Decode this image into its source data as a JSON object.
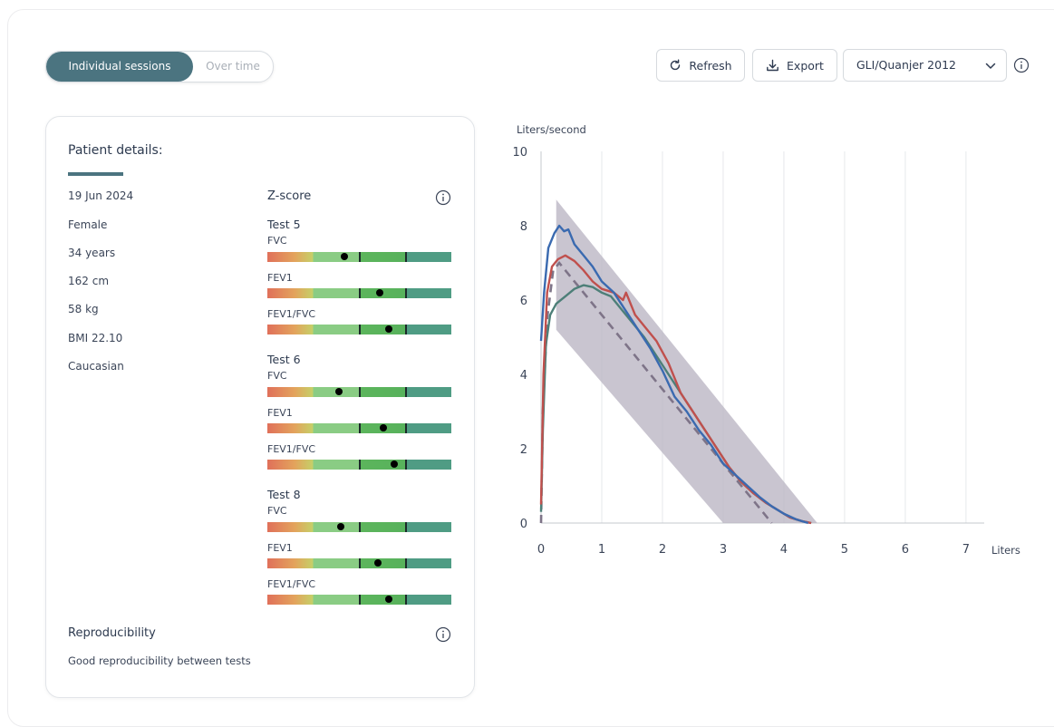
{
  "toggle": {
    "active": "Individual sessions",
    "inactive": "Over time"
  },
  "toolbar": {
    "refresh": "Refresh",
    "export": "Export",
    "reference": "GLI/Quanjer 2012"
  },
  "patient": {
    "title": "Patient details:",
    "details": [
      "19 Jun 2024",
      "Female",
      "34 years",
      "162 cm",
      "58 kg",
      "BMI 22.10",
      "Caucasian"
    ]
  },
  "zscore": {
    "title": "Z-score",
    "tests": [
      {
        "name": "Test 5",
        "metrics": [
          {
            "label": "FVC",
            "position": 0.42
          },
          {
            "label": "FEV1",
            "position": 0.61
          },
          {
            "label": "FEV1/FVC",
            "position": 0.66
          }
        ]
      },
      {
        "name": "Test 6",
        "metrics": [
          {
            "label": "FVC",
            "position": 0.39
          },
          {
            "label": "FEV1",
            "position": 0.63
          },
          {
            "label": "FEV1/FVC",
            "position": 0.69
          }
        ]
      },
      {
        "name": "Test 8",
        "metrics": [
          {
            "label": "FVC",
            "position": 0.4
          },
          {
            "label": "FEV1",
            "position": 0.6
          },
          {
            "label": "FEV1/FVC",
            "position": 0.66
          }
        ]
      }
    ]
  },
  "reproducibility": {
    "title": "Reproducibility",
    "text": "Good reproducibility between tests"
  },
  "colors": {
    "accent": "#4b7480",
    "curve_blue": "#3a6ab0",
    "curve_red": "#c0504d",
    "curve_teal": "#4d7f78",
    "predicted": "#7e7488",
    "band": "#bbb6c4"
  },
  "chart_data": {
    "type": "line",
    "ylabel": "Liters/second",
    "xlabel": "Liters",
    "xlim": [
      0,
      7.3
    ],
    "ylim": [
      0,
      10
    ],
    "x_ticks": [
      0,
      1,
      2,
      3,
      4,
      5,
      6,
      7
    ],
    "y_ticks": [
      0,
      2,
      4,
      6,
      8,
      10
    ],
    "grid": "vertical",
    "band": {
      "upper": [
        [
          0.25,
          8.7
        ],
        [
          4.55,
          0
        ]
      ],
      "lower": [
        [
          0.25,
          5.2
        ],
        [
          3.0,
          0
        ]
      ]
    },
    "predicted": [
      [
        0,
        0
      ],
      [
        0.03,
        3.0
      ],
      [
        0.1,
        5.5
      ],
      [
        0.2,
        6.8
      ],
      [
        0.3,
        7.0
      ],
      [
        3.8,
        0
      ]
    ],
    "series": [
      {
        "color": "#3a6ab0",
        "points": [
          [
            0,
            4.9
          ],
          [
            0.05,
            6.2
          ],
          [
            0.12,
            7.4
          ],
          [
            0.22,
            7.8
          ],
          [
            0.3,
            8.0
          ],
          [
            0.38,
            7.85
          ],
          [
            0.45,
            7.9
          ],
          [
            0.55,
            7.5
          ],
          [
            0.7,
            7.2
          ],
          [
            0.85,
            6.9
          ],
          [
            1.0,
            6.5
          ],
          [
            1.2,
            6.2
          ],
          [
            1.4,
            5.7
          ],
          [
            1.6,
            5.2
          ],
          [
            1.8,
            4.7
          ],
          [
            2.0,
            4.1
          ],
          [
            2.2,
            3.4
          ],
          [
            2.4,
            3.0
          ],
          [
            2.6,
            2.5
          ],
          [
            2.8,
            2.1
          ],
          [
            3.0,
            1.6
          ],
          [
            3.2,
            1.3
          ],
          [
            3.4,
            1.0
          ],
          [
            3.6,
            0.7
          ],
          [
            3.8,
            0.45
          ],
          [
            4.0,
            0.25
          ],
          [
            4.2,
            0.1
          ],
          [
            4.4,
            0.0
          ]
        ]
      },
      {
        "color": "#c0504d",
        "points": [
          [
            0,
            0.5
          ],
          [
            0.04,
            4.0
          ],
          [
            0.1,
            6.2
          ],
          [
            0.18,
            6.9
          ],
          [
            0.28,
            7.1
          ],
          [
            0.4,
            7.2
          ],
          [
            0.55,
            7.05
          ],
          [
            0.7,
            6.8
          ],
          [
            0.85,
            6.5
          ],
          [
            1.0,
            6.3
          ],
          [
            1.2,
            6.2
          ],
          [
            1.35,
            6.0
          ],
          [
            1.4,
            6.2
          ],
          [
            1.55,
            5.6
          ],
          [
            1.7,
            5.3
          ],
          [
            1.9,
            4.9
          ],
          [
            2.1,
            4.3
          ],
          [
            2.3,
            3.5
          ],
          [
            2.5,
            3.0
          ],
          [
            2.7,
            2.5
          ],
          [
            2.9,
            2.0
          ],
          [
            3.1,
            1.5
          ],
          [
            3.3,
            1.1
          ],
          [
            3.5,
            0.8
          ],
          [
            3.7,
            0.55
          ],
          [
            3.9,
            0.35
          ],
          [
            4.1,
            0.15
          ],
          [
            4.3,
            0.05
          ],
          [
            4.45,
            0.0
          ]
        ]
      },
      {
        "color": "#4d7f78",
        "points": [
          [
            0,
            0.3
          ],
          [
            0.03,
            2.5
          ],
          [
            0.08,
            4.8
          ],
          [
            0.15,
            5.6
          ],
          [
            0.25,
            5.9
          ],
          [
            0.4,
            6.1
          ],
          [
            0.55,
            6.3
          ],
          [
            0.7,
            6.4
          ],
          [
            0.85,
            6.35
          ],
          [
            1.0,
            6.2
          ],
          [
            1.15,
            6.1
          ],
          [
            1.3,
            5.8
          ],
          [
            1.5,
            5.4
          ],
          [
            1.7,
            5.0
          ],
          [
            1.9,
            4.5
          ],
          [
            2.1,
            4.0
          ],
          [
            2.3,
            3.5
          ],
          [
            2.5,
            3.0
          ],
          [
            2.7,
            2.5
          ],
          [
            2.9,
            2.0
          ],
          [
            3.1,
            1.5
          ],
          [
            3.3,
            1.1
          ],
          [
            3.5,
            0.8
          ],
          [
            3.7,
            0.55
          ],
          [
            3.9,
            0.35
          ],
          [
            4.1,
            0.15
          ],
          [
            4.3,
            0.05
          ],
          [
            4.45,
            0.0
          ]
        ]
      }
    ]
  }
}
